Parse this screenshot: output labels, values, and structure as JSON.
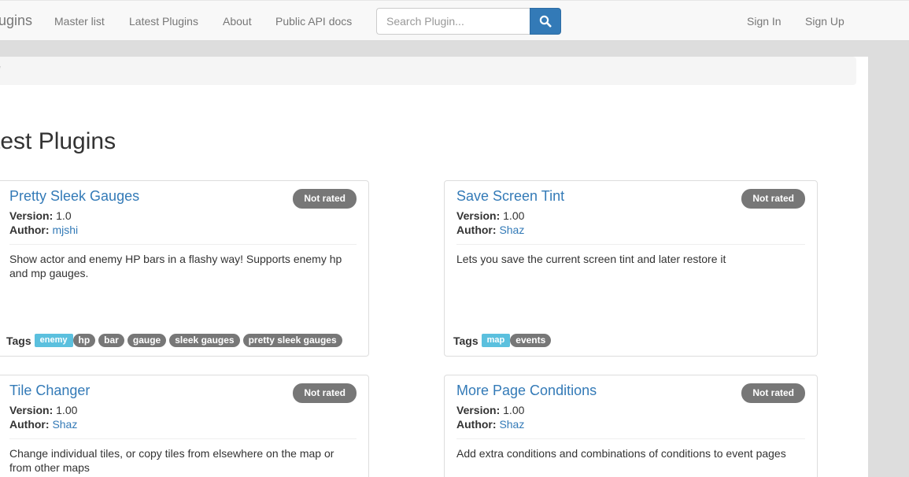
{
  "navbar": {
    "brand": "ugins",
    "links": [
      "Master list",
      "Latest Plugins",
      "About",
      "Public API docs"
    ],
    "search_placeholder": "Search Plugin...",
    "sign_in": "Sign In",
    "sign_up": "Sign Up"
  },
  "breadcrumb": {
    "separator": "/"
  },
  "page": {
    "title": "test Plugins"
  },
  "labels": {
    "version": "Version:",
    "author": "Author:",
    "tags": "Tags"
  },
  "plugins": [
    {
      "title": "Pretty Sleek Gauges",
      "rating": "Not rated",
      "version": "1.0",
      "author": "mjshi",
      "description": "Show actor and enemy HP bars in a flashy way! Supports enemy hp and mp gauges.",
      "tags": [
        "enemy",
        "hp",
        "bar",
        "gauge",
        "sleek gauges",
        "pretty sleek gauges"
      ]
    },
    {
      "title": "Save Screen Tint",
      "rating": "Not rated",
      "version": "1.00",
      "author": "Shaz",
      "description": "Lets you save the current screen tint and later restore it",
      "tags": [
        "map",
        "events"
      ]
    },
    {
      "title": "Tile Changer",
      "rating": "Not rated",
      "version": "1.00",
      "author": "Shaz",
      "description": "Change individual tiles, or copy tiles from elsewhere on the map or from other maps"
    },
    {
      "title": "More Page Conditions",
      "rating": "Not rated",
      "version": "1.00",
      "author": "Shaz",
      "description": "Add extra conditions and combinations of conditions to event pages"
    }
  ],
  "colors": {
    "link": "#337ab7",
    "badge": "#777777",
    "tag_accent": "#5bc0de",
    "search_button": "#337ab7"
  }
}
